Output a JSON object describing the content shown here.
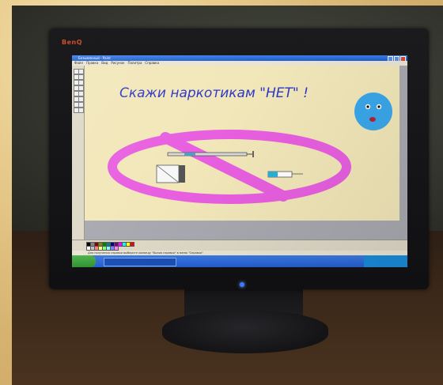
{
  "photo": {
    "monitor_brand": "BenQ",
    "screen": {
      "window_title": "Безымянный - Paint",
      "menu": [
        "Файл",
        "Правка",
        "Вид",
        "Рисунок",
        "Палитра",
        "Справка"
      ],
      "drawing": {
        "headline": "Скажи наркотикам \"НЕТ\" !",
        "colors": {
          "headline": "#2c36c9",
          "prohibition_ring": "#e85fe0",
          "smiley_face": "#3aa7ea",
          "canvas": "#f2e7b9"
        },
        "icons": [
          "prohibition-sign",
          "syringe-icon",
          "sad-face-icon",
          "pill-package-icon"
        ]
      },
      "status_text": "Для получения справки выберите команду \"Вызов справки\" в меню \"Справка\""
    }
  }
}
